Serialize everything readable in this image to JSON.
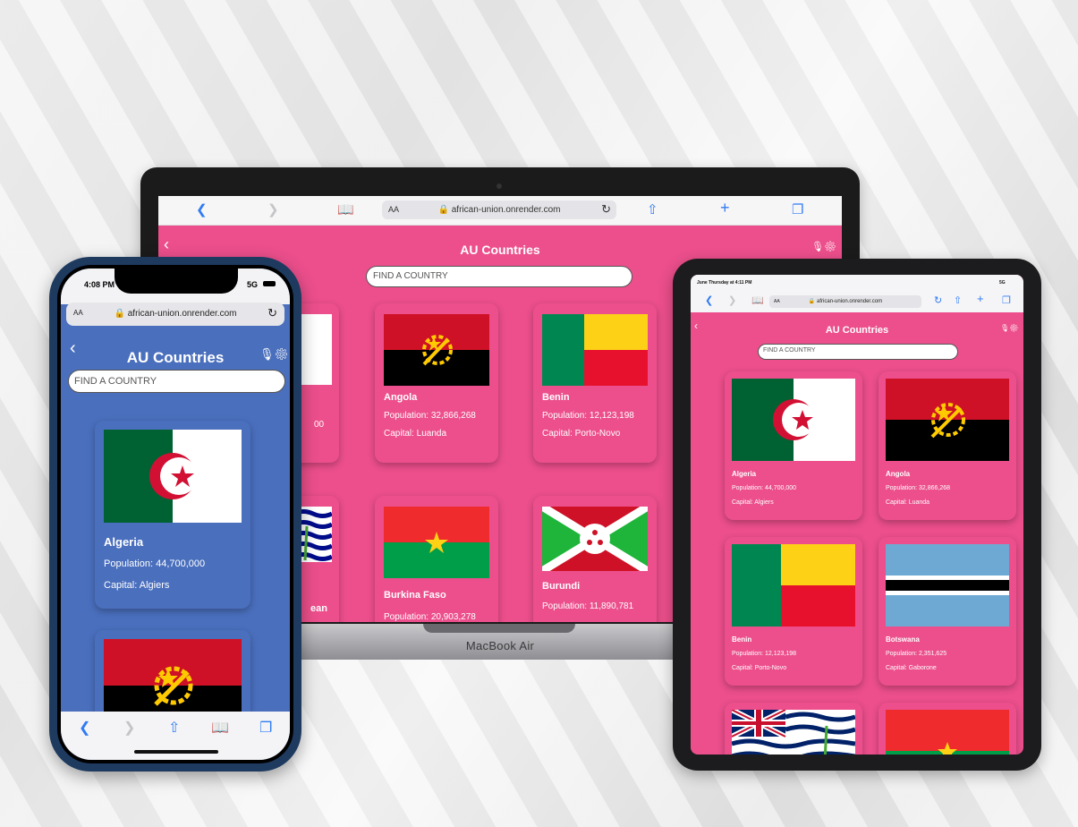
{
  "app": {
    "title": "AU Countries",
    "search_placeholder": "FIND A COUNTRY",
    "url": "african-union.onrender.com",
    "aa": "AA",
    "back": "‹",
    "mic": "🎙",
    "gear": "⚙"
  },
  "device_labels": {
    "laptop": "MacBook Air"
  },
  "phone_status": {
    "time": "4:08 PM",
    "network": "5G"
  },
  "ipad_status": {
    "datetime": "June Thursday at 4:11 PM",
    "network": "5G"
  },
  "countries": [
    {
      "name": "Algeria",
      "population": "Population: 44,700,000",
      "capital": "Capital: Algiers"
    },
    {
      "name": "Angola",
      "population": "Population: 32,866,268",
      "capital": "Capital: Luanda"
    },
    {
      "name": "Benin",
      "population": "Population: 12,123,198",
      "capital": "Capital: Porto-Novo"
    },
    {
      "name": "Botswana",
      "population": "Population: 2,351,625",
      "capital": "Capital: Gaborone"
    },
    {
      "name": "Burkina Faso",
      "population": "Population: 20,903,278",
      "capital": ""
    },
    {
      "name": "Burundi",
      "population": "Population: 11,890,781",
      "capital": ""
    }
  ],
  "partial_texts": {
    "algeria_pop_tail": "00",
    "biot_name_tail": "ean"
  },
  "colors": {
    "laptop_bg": "#ec4f8c",
    "phone_bg": "#4a6fbd",
    "safari_accent": "#2f7bf5"
  }
}
